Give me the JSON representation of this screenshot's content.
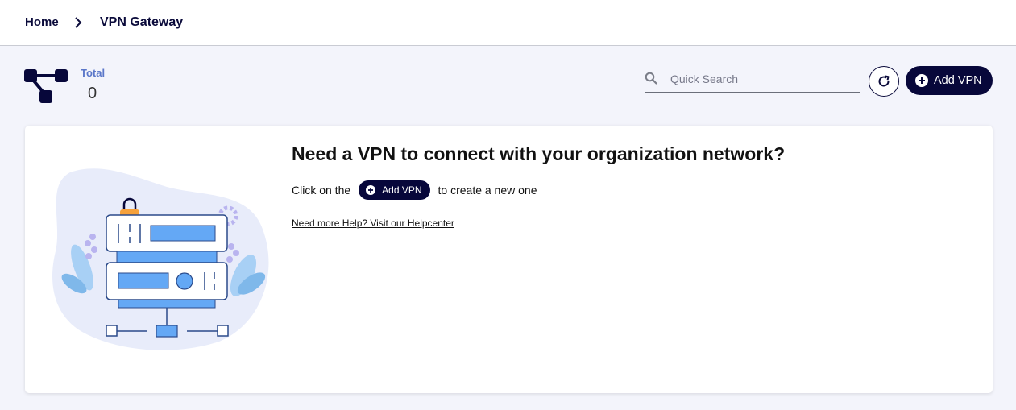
{
  "breadcrumb": {
    "home": "Home",
    "current": "VPN Gateway"
  },
  "stats": {
    "label": "Total",
    "value": "0",
    "icon": "network-nodes-icon"
  },
  "search": {
    "placeholder": "Quick Search",
    "value": ""
  },
  "toolbar": {
    "refresh_icon": "refresh-icon",
    "add_label": "Add VPN"
  },
  "empty_state": {
    "title": "Need a VPN to connect with your organization network?",
    "text_before": "Click on the",
    "button_label": "Add VPN",
    "text_after": "to create a new one",
    "help_link": "Need more Help? Visit our Helpcenter"
  },
  "colors": {
    "primary": "#07073a",
    "accent_blue": "#5b77c9",
    "page_bg": "#f3f4fb",
    "illustration_blue": "#64a8f5"
  }
}
